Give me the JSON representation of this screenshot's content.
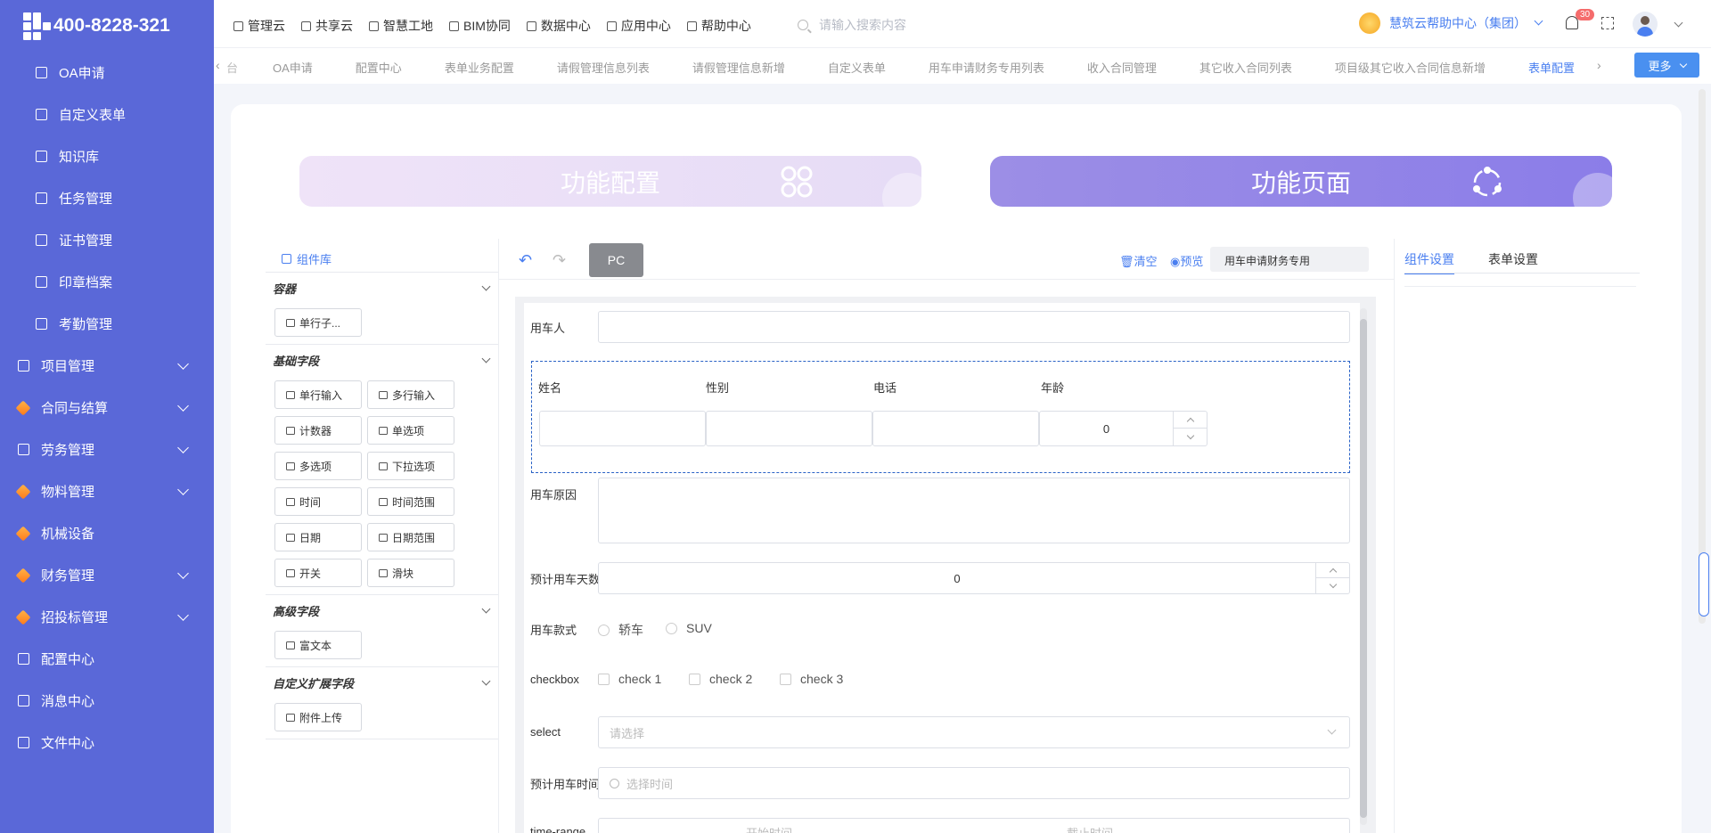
{
  "app": {
    "phone": "400-8228-321"
  },
  "sidebar": {
    "items": [
      {
        "label": "OA申请",
        "type": "sub"
      },
      {
        "label": "自定义表单",
        "type": "sub"
      },
      {
        "label": "知识库",
        "type": "sub"
      },
      {
        "label": "任务管理",
        "type": "sub"
      },
      {
        "label": "证书管理",
        "type": "sub"
      },
      {
        "label": "印章档案",
        "type": "sub"
      },
      {
        "label": "考勤管理",
        "type": "sub"
      },
      {
        "label": "项目管理",
        "type": "top"
      },
      {
        "label": "合同与结算",
        "type": "top"
      },
      {
        "label": "劳务管理",
        "type": "top"
      },
      {
        "label": "物料管理",
        "type": "top"
      },
      {
        "label": "机械设备",
        "type": "top"
      },
      {
        "label": "财务管理",
        "type": "top"
      },
      {
        "label": "招投标管理",
        "type": "top"
      },
      {
        "label": "配置中心",
        "type": "top"
      },
      {
        "label": "消息中心",
        "type": "top"
      },
      {
        "label": "文件中心",
        "type": "top"
      }
    ]
  },
  "topnav": {
    "items": [
      "管理云",
      "共享云",
      "智慧工地",
      "BIM协同",
      "数据中心",
      "应用中心",
      "帮助中心"
    ],
    "search_placeholder": "请输入搜索内容",
    "help_center": "慧筑云帮助中心（集团）",
    "notification_count": "30"
  },
  "tabs": {
    "first_partial": "台",
    "items": [
      "OA申请",
      "配置中心",
      "表单业务配置",
      "请假管理信息列表",
      "请假管理信息新增",
      "自定义表单",
      "用车申请财务专用列表",
      "收入合同管理",
      "其它收入合同列表",
      "项目级其它收入合同信息新增",
      "表单配置"
    ],
    "active": "表单配置",
    "more_label": "更多"
  },
  "banners": {
    "config": "功能配置",
    "page": "功能页面"
  },
  "library": {
    "title": "组件库",
    "groups": [
      {
        "name": "容器",
        "items": [
          "单行子..."
        ]
      },
      {
        "name": "基础字段",
        "items": [
          "单行输入",
          "多行输入",
          "计数器",
          "单选项",
          "多选项",
          "下拉选项",
          "时间",
          "时间范围",
          "日期",
          "日期范围",
          "开关",
          "滑块"
        ]
      },
      {
        "name": "高级字段",
        "items": [
          "富文本"
        ]
      },
      {
        "name": "自定义扩展字段",
        "items": [
          "附件上传"
        ]
      }
    ]
  },
  "toolbar": {
    "pc_label": "PC",
    "clear_label": "清空",
    "preview_label": "预览",
    "form_name": "用车申请财务专用"
  },
  "form": {
    "user_label": "用车人",
    "sub_table": {
      "columns": [
        "姓名",
        "性别",
        "电话",
        "年龄"
      ],
      "age_value": "0"
    },
    "reason_label": "用车原因",
    "days_label": "预计用车天数",
    "days_value": "0",
    "style_label": "用车款式",
    "style_options": [
      "轿车",
      "SUV"
    ],
    "checkbox_label": "checkbox",
    "checkbox_options": [
      "check 1",
      "check 2",
      "check 3"
    ],
    "select_label": "select",
    "select_placeholder": "请选择",
    "time_label": "预计用车时间",
    "time_placeholder": "选择时间",
    "timerange_label": "time-range",
    "timerange_start": "开始时间",
    "timerange_end": "截止时间"
  },
  "settings": {
    "tabs": [
      "组件设置",
      "表单设置"
    ],
    "active": "组件设置"
  }
}
